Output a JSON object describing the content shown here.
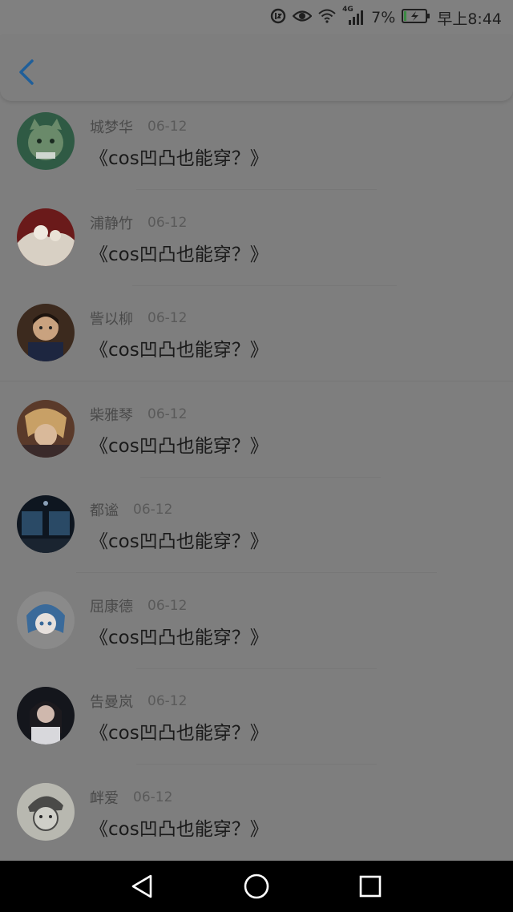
{
  "status_bar": {
    "network": "4G",
    "battery_percent": "7%",
    "time": "早上8:44"
  },
  "header": {
    "back_icon": "chevron-left-icon"
  },
  "list": [
    {
      "username": "城梦华",
      "date": "06-12",
      "title": "《cos凹凸也能穿？》",
      "avatar": "avatar-cat-icon"
    },
    {
      "username": "浦静竹",
      "date": "06-12",
      "title": "《cos凹凸也能穿？》",
      "avatar": "avatar-cake-icon"
    },
    {
      "username": "訾以柳",
      "date": "06-12",
      "title": "《cos凹凸也能穿？》",
      "avatar": "avatar-boy-icon"
    },
    {
      "username": "柴雅琴",
      "date": "06-12",
      "title": "《cos凹凸也能穿？》",
      "avatar": "avatar-anime-blonde-icon"
    },
    {
      "username": "都谧",
      "date": "06-12",
      "title": "《cos凹凸也能穿？》",
      "avatar": "avatar-night-scene-icon"
    },
    {
      "username": "屈康德",
      "date": "06-12",
      "title": "《cos凹凸也能穿？》",
      "avatar": "avatar-anime-blue-hair-icon"
    },
    {
      "username": "告曼岚",
      "date": "06-12",
      "title": "《cos凹凸也能穿？》",
      "avatar": "avatar-girl-icon"
    },
    {
      "username": "衅爱",
      "date": "06-12",
      "title": "《cos凹凸也能穿？》",
      "avatar": "avatar-sketch-icon"
    }
  ],
  "nav_bar": {
    "back": "triangle-back-icon",
    "home": "circle-home-icon",
    "recents": "square-recents-icon"
  },
  "colors": {
    "overlay_background": "#7e7e7e",
    "accent_back": "#1f5f9a"
  }
}
